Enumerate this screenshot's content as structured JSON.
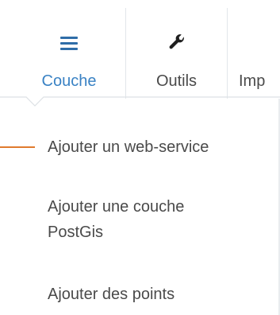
{
  "tabs": [
    {
      "label": "Couche",
      "icon": "hamburger-menu-icon",
      "active": true
    },
    {
      "label": "Outils",
      "icon": "wrench-icon",
      "active": false
    },
    {
      "label": "Imp",
      "icon": "",
      "active": false
    }
  ],
  "menu": {
    "items": [
      {
        "label": "Ajouter un web-service"
      },
      {
        "label_line1": "Ajouter une couche",
        "label_line2": "PostGis"
      },
      {
        "label": "Ajouter des points"
      }
    ]
  },
  "colors": {
    "active_tab": "#3a82c4",
    "icon_blue": "#2f6da8",
    "text": "#4a4a4a",
    "pointer": "#e07a2e",
    "divider": "#e2e6ea"
  }
}
